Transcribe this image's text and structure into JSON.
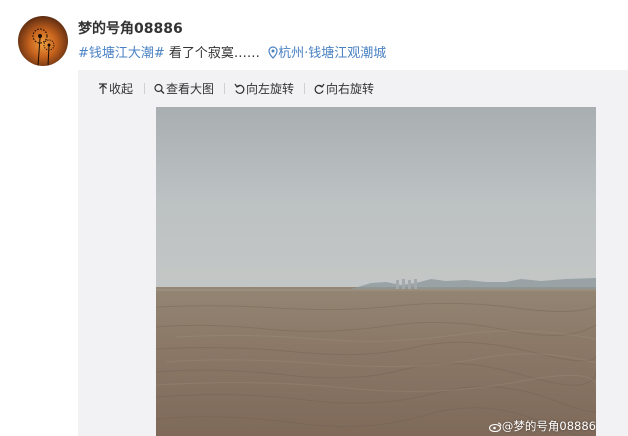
{
  "post": {
    "username": "梦的号角08886",
    "hashtag": "#钱塘江大潮#",
    "text": " 看了个寂寞……",
    "location": "杭州·钱塘江观潮城"
  },
  "toolbar": {
    "collapse_label": "收起",
    "view_large_label": "查看大图",
    "rotate_left_label": "向左旋转",
    "rotate_right_label": "向右旋转"
  },
  "photo": {
    "watermark": "@梦的号角08886",
    "sky_color": "#b9bdbe",
    "water_color": "#8a7564"
  }
}
